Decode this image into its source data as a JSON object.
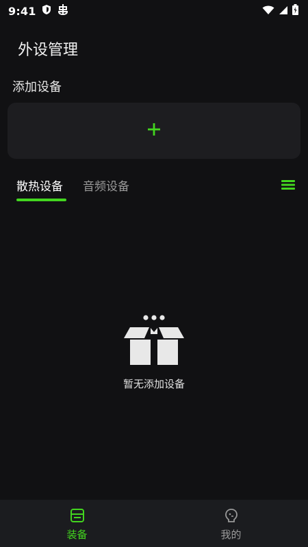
{
  "status_bar": {
    "time": "9:41",
    "icons": [
      "shield-icon",
      "bug-icon",
      "wifi-icon",
      "signal-icon",
      "battery-icon"
    ]
  },
  "header": {
    "title": "外设管理"
  },
  "add_section": {
    "label": "添加设备",
    "add_icon": "plus-icon"
  },
  "tabs": [
    {
      "label": "散热设备",
      "active": true
    },
    {
      "label": "音频设备",
      "active": false
    }
  ],
  "tab_menu_icon": "list-menu-icon",
  "empty_state": {
    "icon": "empty-box-icon",
    "text": "暂无添加设备"
  },
  "bottom_nav": [
    {
      "label": "装备",
      "icon": "equipment-icon",
      "active": true
    },
    {
      "label": "我的",
      "icon": "profile-icon",
      "active": false
    }
  ],
  "colors": {
    "background": "#111113",
    "card": "#1d1d20",
    "accent": "#43d61f",
    "nav_bg": "#1b1c1f",
    "muted_text": "#9a9a9a"
  }
}
